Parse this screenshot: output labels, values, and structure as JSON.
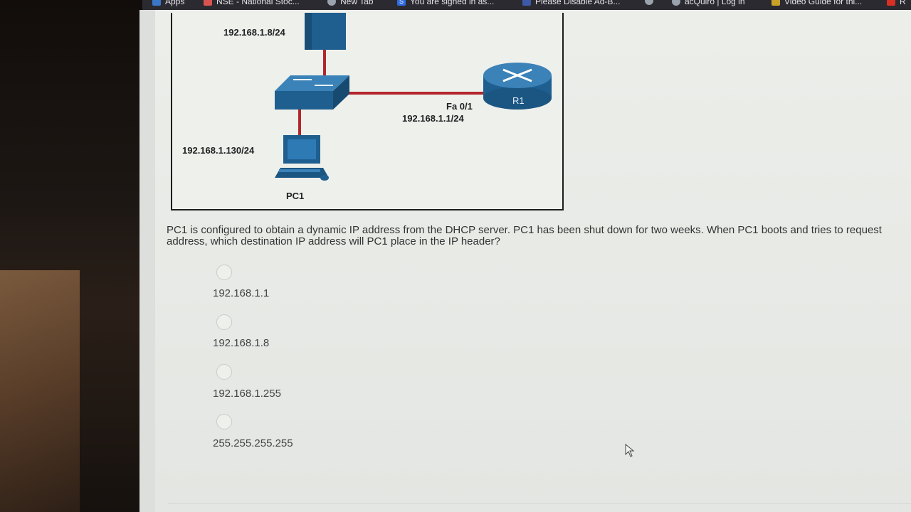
{
  "bookmarks": [
    {
      "label": "Apps",
      "icon": "apps-grid-icon"
    },
    {
      "label": "NSE - National Stoc...",
      "icon": "nse-icon"
    },
    {
      "label": "New Tab",
      "icon": "globe-icon"
    },
    {
      "label": "You are signed in as...",
      "icon": "s-icon"
    },
    {
      "label": "Please Disable Ad-B...",
      "icon": "site-icon"
    },
    {
      "label": "",
      "icon": "globe-icon"
    },
    {
      "label": "acQuiro | Log in",
      "icon": "globe-icon"
    },
    {
      "label": "Video Guide for thi...",
      "icon": "bookmark-icon"
    },
    {
      "label": "R",
      "icon": "gmail-icon"
    }
  ],
  "diagram": {
    "server_ip": "192.168.1.8/24",
    "router_name": "R1",
    "router_interface": "Fa 0/1",
    "router_ip": "192.168.1.1/24",
    "pc_ip": "192.168.1.130/24",
    "pc_name": "PC1",
    "link_color": "#b3262b",
    "device_color": "#1f5f8f"
  },
  "question": {
    "line1": "PC1 is configured to obtain a dynamic IP address from the DHCP server. PC1 has been shut down for two weeks. When PC1 boots and tries to request",
    "line2": "address, which destination IP address will PC1 place in the IP header?"
  },
  "options": [
    {
      "label": "192.168.1.1"
    },
    {
      "label": "192.168.1.8"
    },
    {
      "label": "192.168.1.255"
    },
    {
      "label": "255.255.255.255"
    }
  ]
}
